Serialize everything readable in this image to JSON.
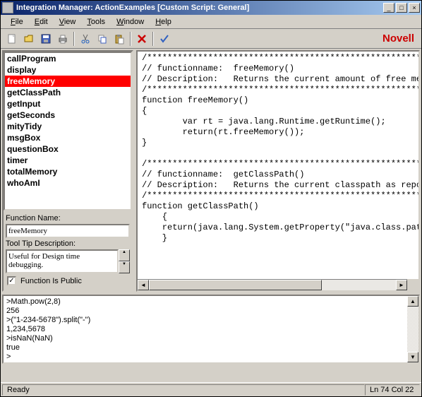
{
  "title": "Integration Manager: ActionExamples [Custom Script: General]",
  "menubar": {
    "items": [
      "File",
      "Edit",
      "View",
      "Tools",
      "Window",
      "Help"
    ]
  },
  "brand": "Novell",
  "functions": {
    "items": [
      "callProgram",
      "display",
      "freeMemory",
      "getClassPath",
      "getInput",
      "getSeconds",
      "mityTidy",
      "msgBox",
      "questionBox",
      "timer",
      "totalMemory",
      "whoAmI"
    ],
    "selected_index": 2
  },
  "form": {
    "name_label": "Function Name:",
    "name_value": "freeMemory",
    "tooltip_label": "Tool Tip Description:",
    "tooltip_value": "Useful for Design time debugging.",
    "public_label": "Function Is Public",
    "public_checked": true
  },
  "code": "/*****************************************************************\n// functionname:  freeMemory()\n// Description:   Returns the current amount of free memory\n/*****************************************************************\nfunction freeMemory()\n{\n        var rt = java.lang.Runtime.getRuntime();\n        return(rt.freeMemory());\n}\n\n/*****************************************************************\n// functionname:  getClassPath()\n// Description:   Returns the current classpath as reported\n/*****************************************************************\nfunction getClassPath()\n    {\n    return(java.lang.System.getProperty(\"java.class.path\"));\n    }",
  "console": ">Math.pow(2,8)\n256\n>(\"1-234-5678\").split(\"-\")\n1,234,5678\n>isNaN(NaN)\ntrue\n>",
  "status": {
    "ready": "Ready",
    "pos": "Ln 74 Col 22"
  }
}
